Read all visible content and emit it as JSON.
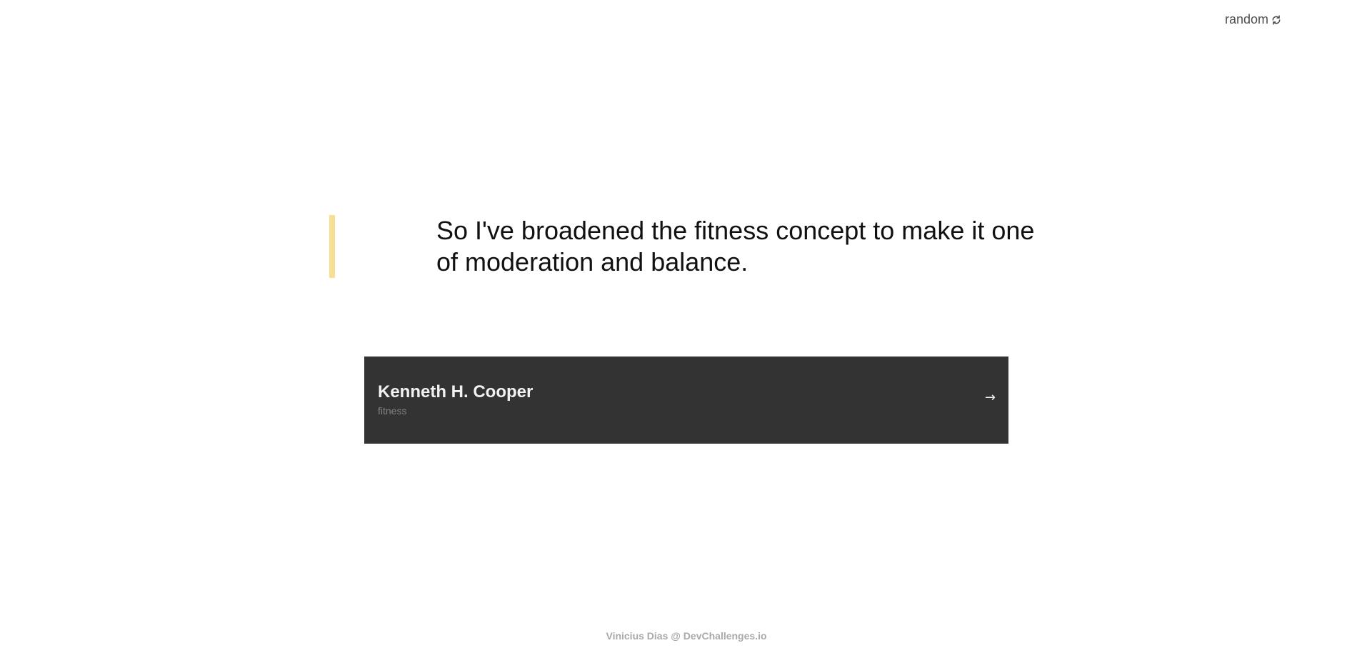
{
  "header": {
    "random_label": "random",
    "random_icon": "refresh-icon"
  },
  "quote": {
    "text": "So I've broadened the fitness concept to make it one of moderation and balance.",
    "accent_color": "#f7df94"
  },
  "author": {
    "name": "Kenneth H. Cooper",
    "genre": "fitness",
    "arrow": "→",
    "card_color": "#333333"
  },
  "footer": {
    "credit": "Vinicius Dias @ DevChallenges.io"
  }
}
